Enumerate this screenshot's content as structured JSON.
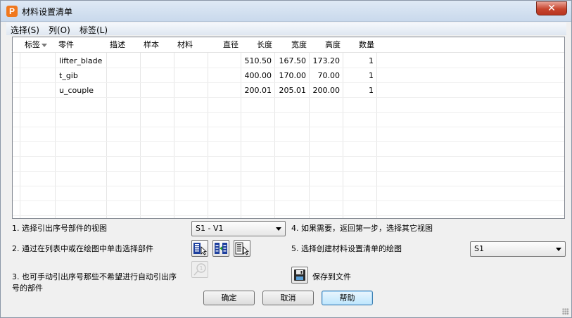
{
  "window": {
    "title": "材料设置清单",
    "close_glyph": "✕"
  },
  "menu": {
    "items": [
      "选择(S)",
      "列(O)",
      "标签(L)"
    ]
  },
  "table": {
    "columns": [
      "标签",
      "零件",
      "描述",
      "样本",
      "材料",
      "直径",
      "长度",
      "宽度",
      "高度",
      "数量"
    ],
    "rows": [
      [
        "",
        "lifter_blade",
        "",
        "",
        "",
        "",
        "510.50",
        "167.50",
        "173.20",
        "1"
      ],
      [
        "",
        "t_gib",
        "",
        "",
        "",
        "",
        "400.00",
        "170.00",
        "70.00",
        "1"
      ],
      [
        "",
        "u_couple",
        "",
        "",
        "",
        "",
        "200.01",
        "205.01",
        "200.00",
        "1"
      ]
    ]
  },
  "steps": {
    "step1": "1. 选择引出序号部件的视图",
    "step2": "2. 通过在列表中或在绘图中单击选择部件",
    "step3_line1": "3. 也可手动引出序号那些不希望进行自动引出序",
    "step3_line2": "号的部件",
    "step4": "4. 如果需要，返回第一步，选择其它视图",
    "step5": "5. 选择创建材料设置清单的绘图"
  },
  "view_combo": {
    "value": "S1 - V1"
  },
  "drawing_combo": {
    "value": "S1"
  },
  "save": {
    "label": "保存到文件"
  },
  "buttons": {
    "ok": "确定",
    "cancel": "取消",
    "help": "帮助"
  },
  "colors": {
    "title_bar": "#c9d9ec",
    "close_button": "#c7452e",
    "app_icon": "#f0781e",
    "default_button": "#bee6fd"
  }
}
